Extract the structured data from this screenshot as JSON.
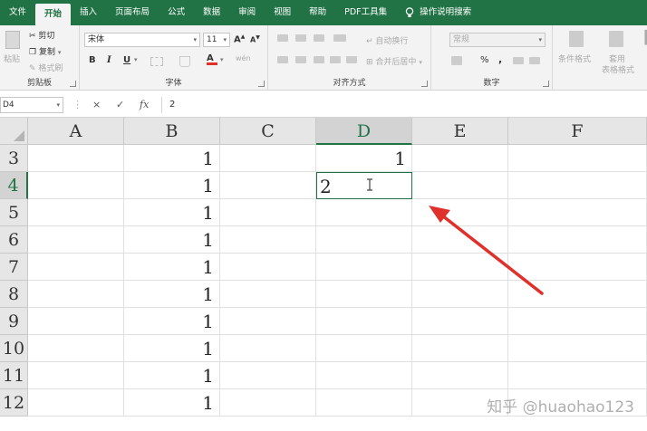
{
  "colors": {
    "brand": "#217346",
    "arrow": "#e0302a"
  },
  "menu": {
    "items": [
      "文件",
      "开始",
      "插入",
      "页面布局",
      "公式",
      "数据",
      "审阅",
      "视图",
      "帮助",
      "PDF工具集"
    ],
    "active_index": 1,
    "tell_me": "操作说明搜索",
    "tell_me_icon": "lightbulb-icon"
  },
  "ribbon": {
    "clipboard": {
      "label": "剪贴板",
      "paste": "粘贴",
      "cut": "剪切",
      "copy": "复制",
      "format_painter": "格式刷"
    },
    "font": {
      "label": "字体",
      "name": "宋体",
      "size": "11",
      "bold": "B",
      "italic": "I",
      "underline": "U",
      "grow": "A",
      "shrink": "A",
      "color_letter": "A",
      "phonetic": "wén"
    },
    "alignment": {
      "label": "对齐方式",
      "wrap": "自动换行",
      "merge": "合并后居中"
    },
    "number": {
      "label": "数字",
      "format": "常规",
      "percent": "%",
      "comma": ","
    },
    "styles": {
      "conditional": "条件格式",
      "table_line1": "套用",
      "table_line2": "表格格式"
    }
  },
  "formula_bar": {
    "name_box": "D4",
    "cancel": "×",
    "enter": "✓",
    "fx": "fx",
    "value": "2"
  },
  "grid": {
    "columns": [
      "A",
      "B",
      "C",
      "D",
      "E",
      "F"
    ],
    "selected_column": "D",
    "rows": [
      {
        "label": "3",
        "B": "1",
        "D": "1"
      },
      {
        "label": "4",
        "B": "1",
        "D": "2"
      },
      {
        "label": "5",
        "B": "1"
      },
      {
        "label": "6",
        "B": "1"
      },
      {
        "label": "7",
        "B": "1"
      },
      {
        "label": "8",
        "B": "1"
      },
      {
        "label": "9",
        "B": "1"
      },
      {
        "label": "10",
        "B": "1"
      },
      {
        "label": "11",
        "B": "1"
      },
      {
        "label": "12",
        "B": "1"
      }
    ],
    "selected_row": "4"
  },
  "watermark": "知乎 @huaohao123"
}
